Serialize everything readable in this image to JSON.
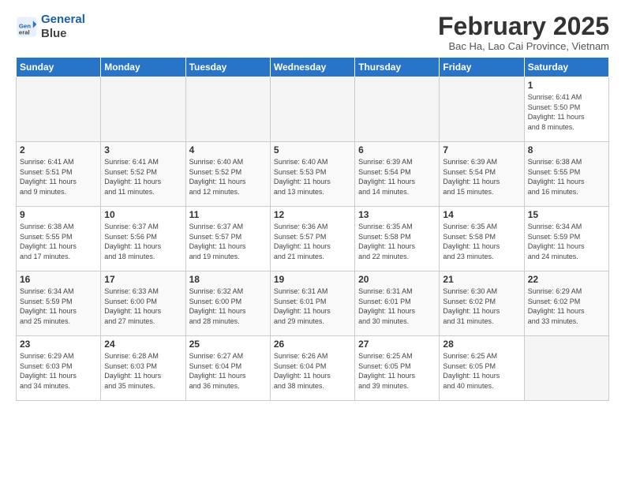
{
  "logo": {
    "line1": "General",
    "line2": "Blue"
  },
  "title": "February 2025",
  "subtitle": "Bac Ha, Lao Cai Province, Vietnam",
  "headers": [
    "Sunday",
    "Monday",
    "Tuesday",
    "Wednesday",
    "Thursday",
    "Friday",
    "Saturday"
  ],
  "weeks": [
    [
      {
        "day": "",
        "info": ""
      },
      {
        "day": "",
        "info": ""
      },
      {
        "day": "",
        "info": ""
      },
      {
        "day": "",
        "info": ""
      },
      {
        "day": "",
        "info": ""
      },
      {
        "day": "",
        "info": ""
      },
      {
        "day": "1",
        "info": "Sunrise: 6:41 AM\nSunset: 5:50 PM\nDaylight: 11 hours\nand 8 minutes."
      }
    ],
    [
      {
        "day": "2",
        "info": "Sunrise: 6:41 AM\nSunset: 5:51 PM\nDaylight: 11 hours\nand 9 minutes."
      },
      {
        "day": "3",
        "info": "Sunrise: 6:41 AM\nSunset: 5:52 PM\nDaylight: 11 hours\nand 11 minutes."
      },
      {
        "day": "4",
        "info": "Sunrise: 6:40 AM\nSunset: 5:52 PM\nDaylight: 11 hours\nand 12 minutes."
      },
      {
        "day": "5",
        "info": "Sunrise: 6:40 AM\nSunset: 5:53 PM\nDaylight: 11 hours\nand 13 minutes."
      },
      {
        "day": "6",
        "info": "Sunrise: 6:39 AM\nSunset: 5:54 PM\nDaylight: 11 hours\nand 14 minutes."
      },
      {
        "day": "7",
        "info": "Sunrise: 6:39 AM\nSunset: 5:54 PM\nDaylight: 11 hours\nand 15 minutes."
      },
      {
        "day": "8",
        "info": "Sunrise: 6:38 AM\nSunset: 5:55 PM\nDaylight: 11 hours\nand 16 minutes."
      }
    ],
    [
      {
        "day": "9",
        "info": "Sunrise: 6:38 AM\nSunset: 5:55 PM\nDaylight: 11 hours\nand 17 minutes."
      },
      {
        "day": "10",
        "info": "Sunrise: 6:37 AM\nSunset: 5:56 PM\nDaylight: 11 hours\nand 18 minutes."
      },
      {
        "day": "11",
        "info": "Sunrise: 6:37 AM\nSunset: 5:57 PM\nDaylight: 11 hours\nand 19 minutes."
      },
      {
        "day": "12",
        "info": "Sunrise: 6:36 AM\nSunset: 5:57 PM\nDaylight: 11 hours\nand 21 minutes."
      },
      {
        "day": "13",
        "info": "Sunrise: 6:35 AM\nSunset: 5:58 PM\nDaylight: 11 hours\nand 22 minutes."
      },
      {
        "day": "14",
        "info": "Sunrise: 6:35 AM\nSunset: 5:58 PM\nDaylight: 11 hours\nand 23 minutes."
      },
      {
        "day": "15",
        "info": "Sunrise: 6:34 AM\nSunset: 5:59 PM\nDaylight: 11 hours\nand 24 minutes."
      }
    ],
    [
      {
        "day": "16",
        "info": "Sunrise: 6:34 AM\nSunset: 5:59 PM\nDaylight: 11 hours\nand 25 minutes."
      },
      {
        "day": "17",
        "info": "Sunrise: 6:33 AM\nSunset: 6:00 PM\nDaylight: 11 hours\nand 27 minutes."
      },
      {
        "day": "18",
        "info": "Sunrise: 6:32 AM\nSunset: 6:00 PM\nDaylight: 11 hours\nand 28 minutes."
      },
      {
        "day": "19",
        "info": "Sunrise: 6:31 AM\nSunset: 6:01 PM\nDaylight: 11 hours\nand 29 minutes."
      },
      {
        "day": "20",
        "info": "Sunrise: 6:31 AM\nSunset: 6:01 PM\nDaylight: 11 hours\nand 30 minutes."
      },
      {
        "day": "21",
        "info": "Sunrise: 6:30 AM\nSunset: 6:02 PM\nDaylight: 11 hours\nand 31 minutes."
      },
      {
        "day": "22",
        "info": "Sunrise: 6:29 AM\nSunset: 6:02 PM\nDaylight: 11 hours\nand 33 minutes."
      }
    ],
    [
      {
        "day": "23",
        "info": "Sunrise: 6:29 AM\nSunset: 6:03 PM\nDaylight: 11 hours\nand 34 minutes."
      },
      {
        "day": "24",
        "info": "Sunrise: 6:28 AM\nSunset: 6:03 PM\nDaylight: 11 hours\nand 35 minutes."
      },
      {
        "day": "25",
        "info": "Sunrise: 6:27 AM\nSunset: 6:04 PM\nDaylight: 11 hours\nand 36 minutes."
      },
      {
        "day": "26",
        "info": "Sunrise: 6:26 AM\nSunset: 6:04 PM\nDaylight: 11 hours\nand 38 minutes."
      },
      {
        "day": "27",
        "info": "Sunrise: 6:25 AM\nSunset: 6:05 PM\nDaylight: 11 hours\nand 39 minutes."
      },
      {
        "day": "28",
        "info": "Sunrise: 6:25 AM\nSunset: 6:05 PM\nDaylight: 11 hours\nand 40 minutes."
      },
      {
        "day": "",
        "info": ""
      }
    ]
  ]
}
